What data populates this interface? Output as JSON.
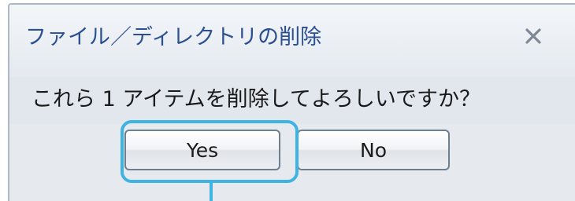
{
  "dialog": {
    "title": "ファイル／ディレクトリの削除",
    "message": "これら 1 アイテムを削除してよろしいですか？",
    "close_icon": "close-icon",
    "buttons": {
      "yes_label": "Yes",
      "no_label": "No"
    }
  },
  "colors": {
    "title_text": "#2b4f93",
    "highlight": "#3fb3e3",
    "dialog_background": "#e6eaef",
    "dialog_border": "#aeb7c3"
  }
}
